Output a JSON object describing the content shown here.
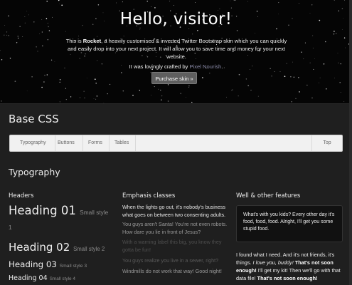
{
  "hero": {
    "title": "Hello, visitor!",
    "intro_prefix": "This is ",
    "intro_brand": "Rocket",
    "intro_rest": ", a heavily customised & inverted Twitter Bootstrap skin which you can quickly and easily drop into your next project. It will allow you to save time and money for your next website.",
    "crafted_prefix": "It was lovingly crafted by ",
    "crafted_link": "Pixel Nourish",
    "crafted_suffix": ".",
    "purchase_label": "Purchase skin »"
  },
  "base_title": "Base CSS",
  "subnav": {
    "items": [
      "Typography",
      "Buttons",
      "Forms",
      "Tables"
    ],
    "top": "Top"
  },
  "typography_title": "Typography",
  "headers": {
    "title": "Headers",
    "h1": "Heading 01",
    "h1_small": "Small style",
    "h1_small_num": "1",
    "h2": "Heading 02",
    "h2_small": "Small style 2",
    "h3": "Heading 03",
    "h3_small": "Small style 3",
    "h4": "Heading 04",
    "h4_small": "Small style 4"
  },
  "emphasis": {
    "title": "Emphasis classes",
    "p1": "When the lights go out, it's nobody's business what goes on between two consenting adults.",
    "p2": "You guys aren't Santa! You're not even robots. How dare you lie in front of Jesus?",
    "p3": "With a warning label this big, you know they gotta be fun!",
    "p4": "You guys realize you live in a sewer, right?",
    "p5": "Windmills do not work that way! Good night!"
  },
  "well": {
    "title": "Well & other features",
    "text": "What's with you kids? Every other day it's food, food, food. Alright, I'll get you some stupid food."
  },
  "found": {
    "t1": "I found what I need. And it's not friends, it's things. ",
    "t2": "I love you, buddy!",
    "t3": "That's not soon enough!",
    "t4": " I'll get my kit! Then we'll go with that data file! ",
    "t5": "That's not soon enough!"
  },
  "colors": {
    "page_bg": "#1f1f1f",
    "hero_bg": "#050505",
    "link": "#8a8aa8",
    "success": "#6a8a5a",
    "warning": "#8a6a3a",
    "error": "#8a3a3a",
    "info": "#4a6a8a",
    "muted": "#6a6a6a"
  }
}
